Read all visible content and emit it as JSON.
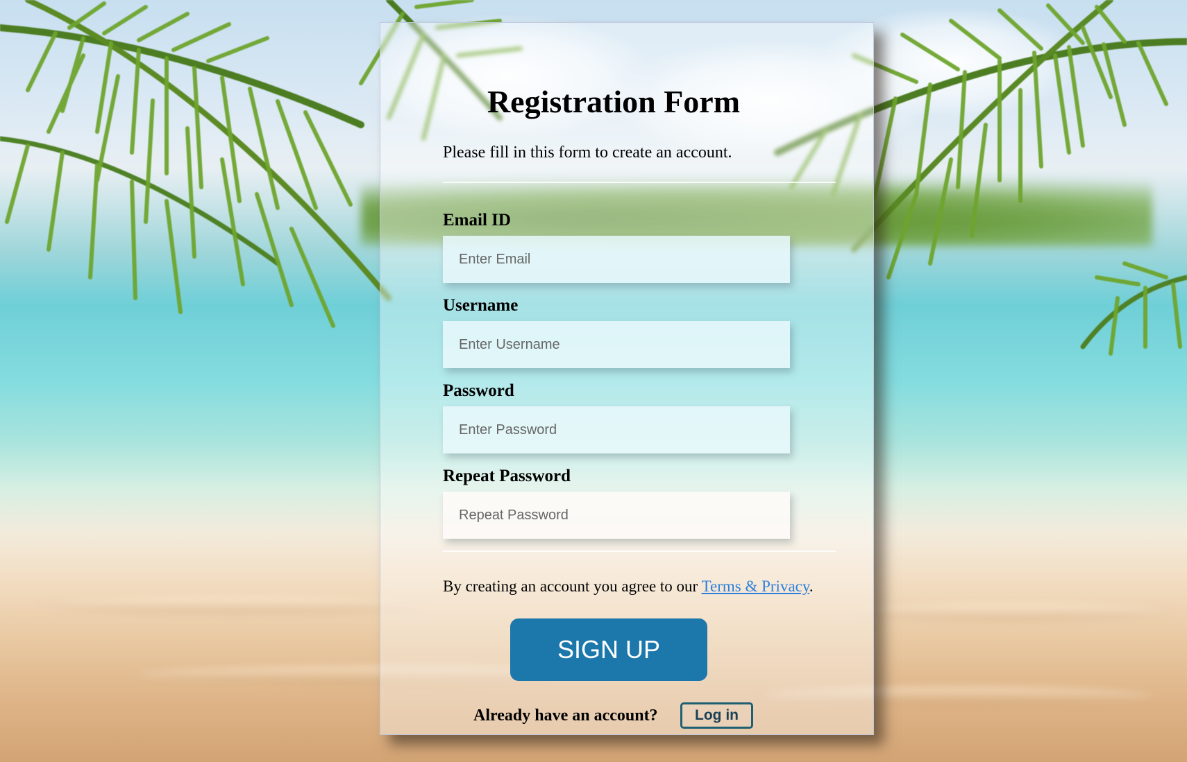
{
  "form": {
    "title": "Registration Form",
    "subtitle": "Please fill in this form to create an account.",
    "fields": [
      {
        "label": "Email ID",
        "placeholder": "Enter Email",
        "value": ""
      },
      {
        "label": "Username",
        "placeholder": "Enter Username",
        "value": ""
      },
      {
        "label": "Password",
        "placeholder": "Enter Password",
        "value": ""
      },
      {
        "label": "Repeat Password",
        "placeholder": "Repeat Password",
        "value": ""
      }
    ],
    "terms_prefix": "By creating an account you agree to our ",
    "terms_link": "Terms & Privacy",
    "terms_suffix": ".",
    "signup_label": "SIGN UP",
    "already_text": "Already have an account?",
    "login_label": "Log in"
  },
  "colors": {
    "signup_button": "#1c77aa",
    "terms_link": "#2b7fdc",
    "login_border": "#1f5f73"
  },
  "icons": {
    "background": "tropical-beach-background"
  }
}
